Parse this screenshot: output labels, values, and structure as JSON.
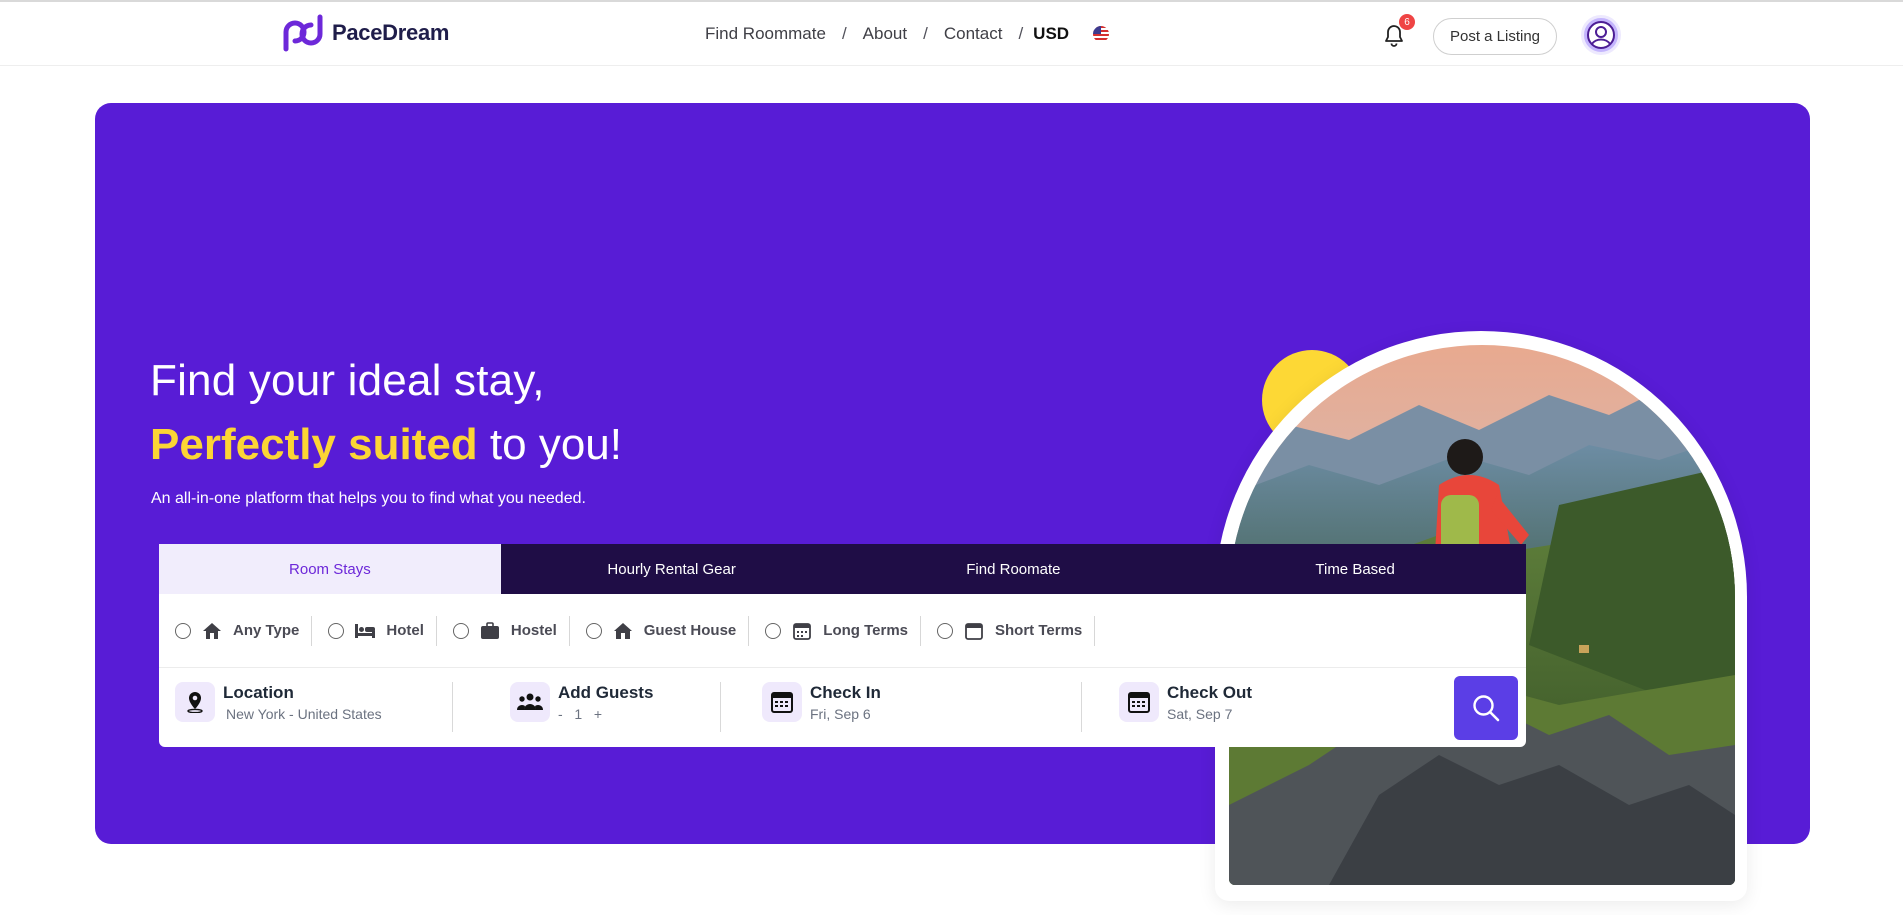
{
  "brand": {
    "name": "PaceDream",
    "accent": "#581cd6",
    "highlight": "#fcd535"
  },
  "nav": {
    "items": [
      "Find Roommate",
      "About",
      "Contact"
    ],
    "separator": "/",
    "currency": "USD",
    "flag_icon": "us-flag-icon"
  },
  "header": {
    "notifications_count": "6",
    "post_listing_label": "Post a Listing",
    "avatar_icon": "user-circle-icon"
  },
  "hero": {
    "title_line1": "Find your ideal stay,",
    "title_highlight": "Perfectly suited",
    "title_rest": " to you!",
    "subtitle": "An all-in-one platform that helps you to find what you needed."
  },
  "search": {
    "tabs": [
      {
        "label": "Room Stays",
        "active": true
      },
      {
        "label": "Hourly Rental Gear",
        "active": false
      },
      {
        "label": "Find Roomate",
        "active": false
      },
      {
        "label": "Time Based",
        "active": false
      }
    ],
    "types": [
      {
        "label": "Any Type",
        "icon": "home-icon"
      },
      {
        "label": "Hotel",
        "icon": "bed-icon"
      },
      {
        "label": "Hostel",
        "icon": "briefcase-icon"
      },
      {
        "label": "Guest House",
        "icon": "house-icon"
      },
      {
        "label": "Long Terms",
        "icon": "calendar-grid-icon"
      },
      {
        "label": "Short Terms",
        "icon": "calendar-icon"
      }
    ],
    "location": {
      "title": "Location",
      "value": "New York - United States"
    },
    "guests": {
      "title": "Add Guests",
      "minus": "-",
      "count": "1",
      "plus": "+"
    },
    "check_in": {
      "title": "Check In",
      "value": "Fri, Sep 6"
    },
    "check_out": {
      "title": "Check Out",
      "value": "Sat, Sep 7"
    },
    "search_icon": "search-icon"
  }
}
